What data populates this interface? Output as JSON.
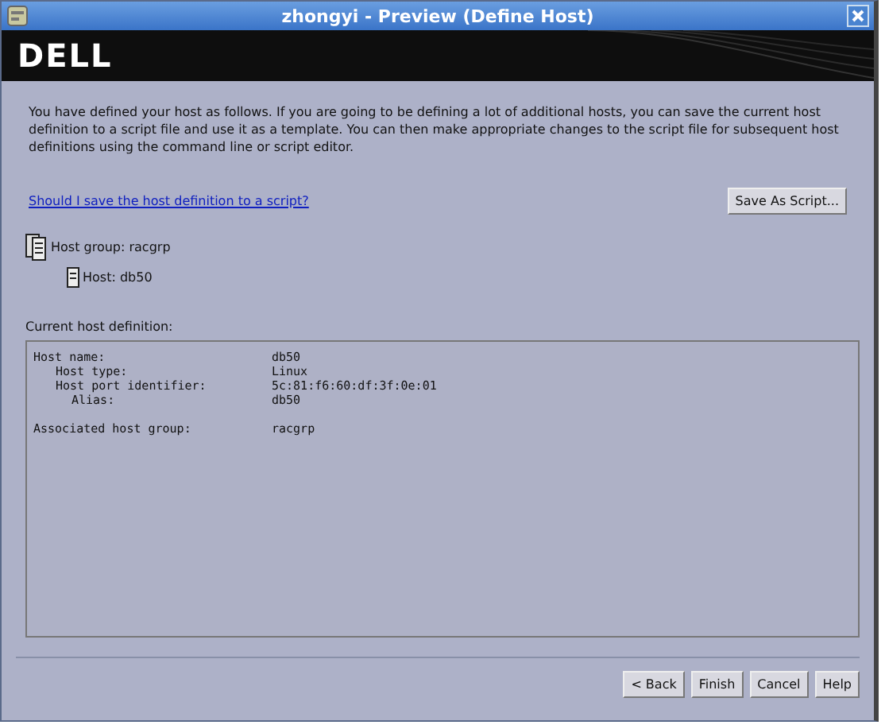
{
  "window": {
    "title": "zhongyi - Preview (Define Host)"
  },
  "banner": {
    "logo": "DELL"
  },
  "intro": "You have defined your host as follows.  If you are going to be defining a lot of additional hosts, you can save the current host definition to a script file and use it as a template. You can then make appropriate changes to the script file for subsequent host definitions using the command line or script editor.",
  "help_link": "Should I save the host definition to a script?",
  "save_button": "Save As Script...",
  "tree": [
    {
      "label": "Host group: racgrp",
      "kind": "group",
      "children": [
        {
          "label": "Host: db50",
          "kind": "host"
        }
      ]
    }
  ],
  "definition_label": "Current host definition:",
  "definition": [
    {
      "label": "Host name:",
      "value": "db50",
      "children": [
        {
          "label": "Host type:",
          "value": "Linux"
        },
        {
          "label": "Host port identifier:",
          "value": "5c:81:f6:60:df:3f:0e:01",
          "children": [
            {
              "label": "Alias:",
              "value": "db50"
            }
          ]
        }
      ]
    },
    {
      "label": "Associated host group:",
      "value": "racgrp"
    }
  ],
  "buttons": [
    "< Back",
    "Finish",
    "Cancel",
    "Help"
  ]
}
